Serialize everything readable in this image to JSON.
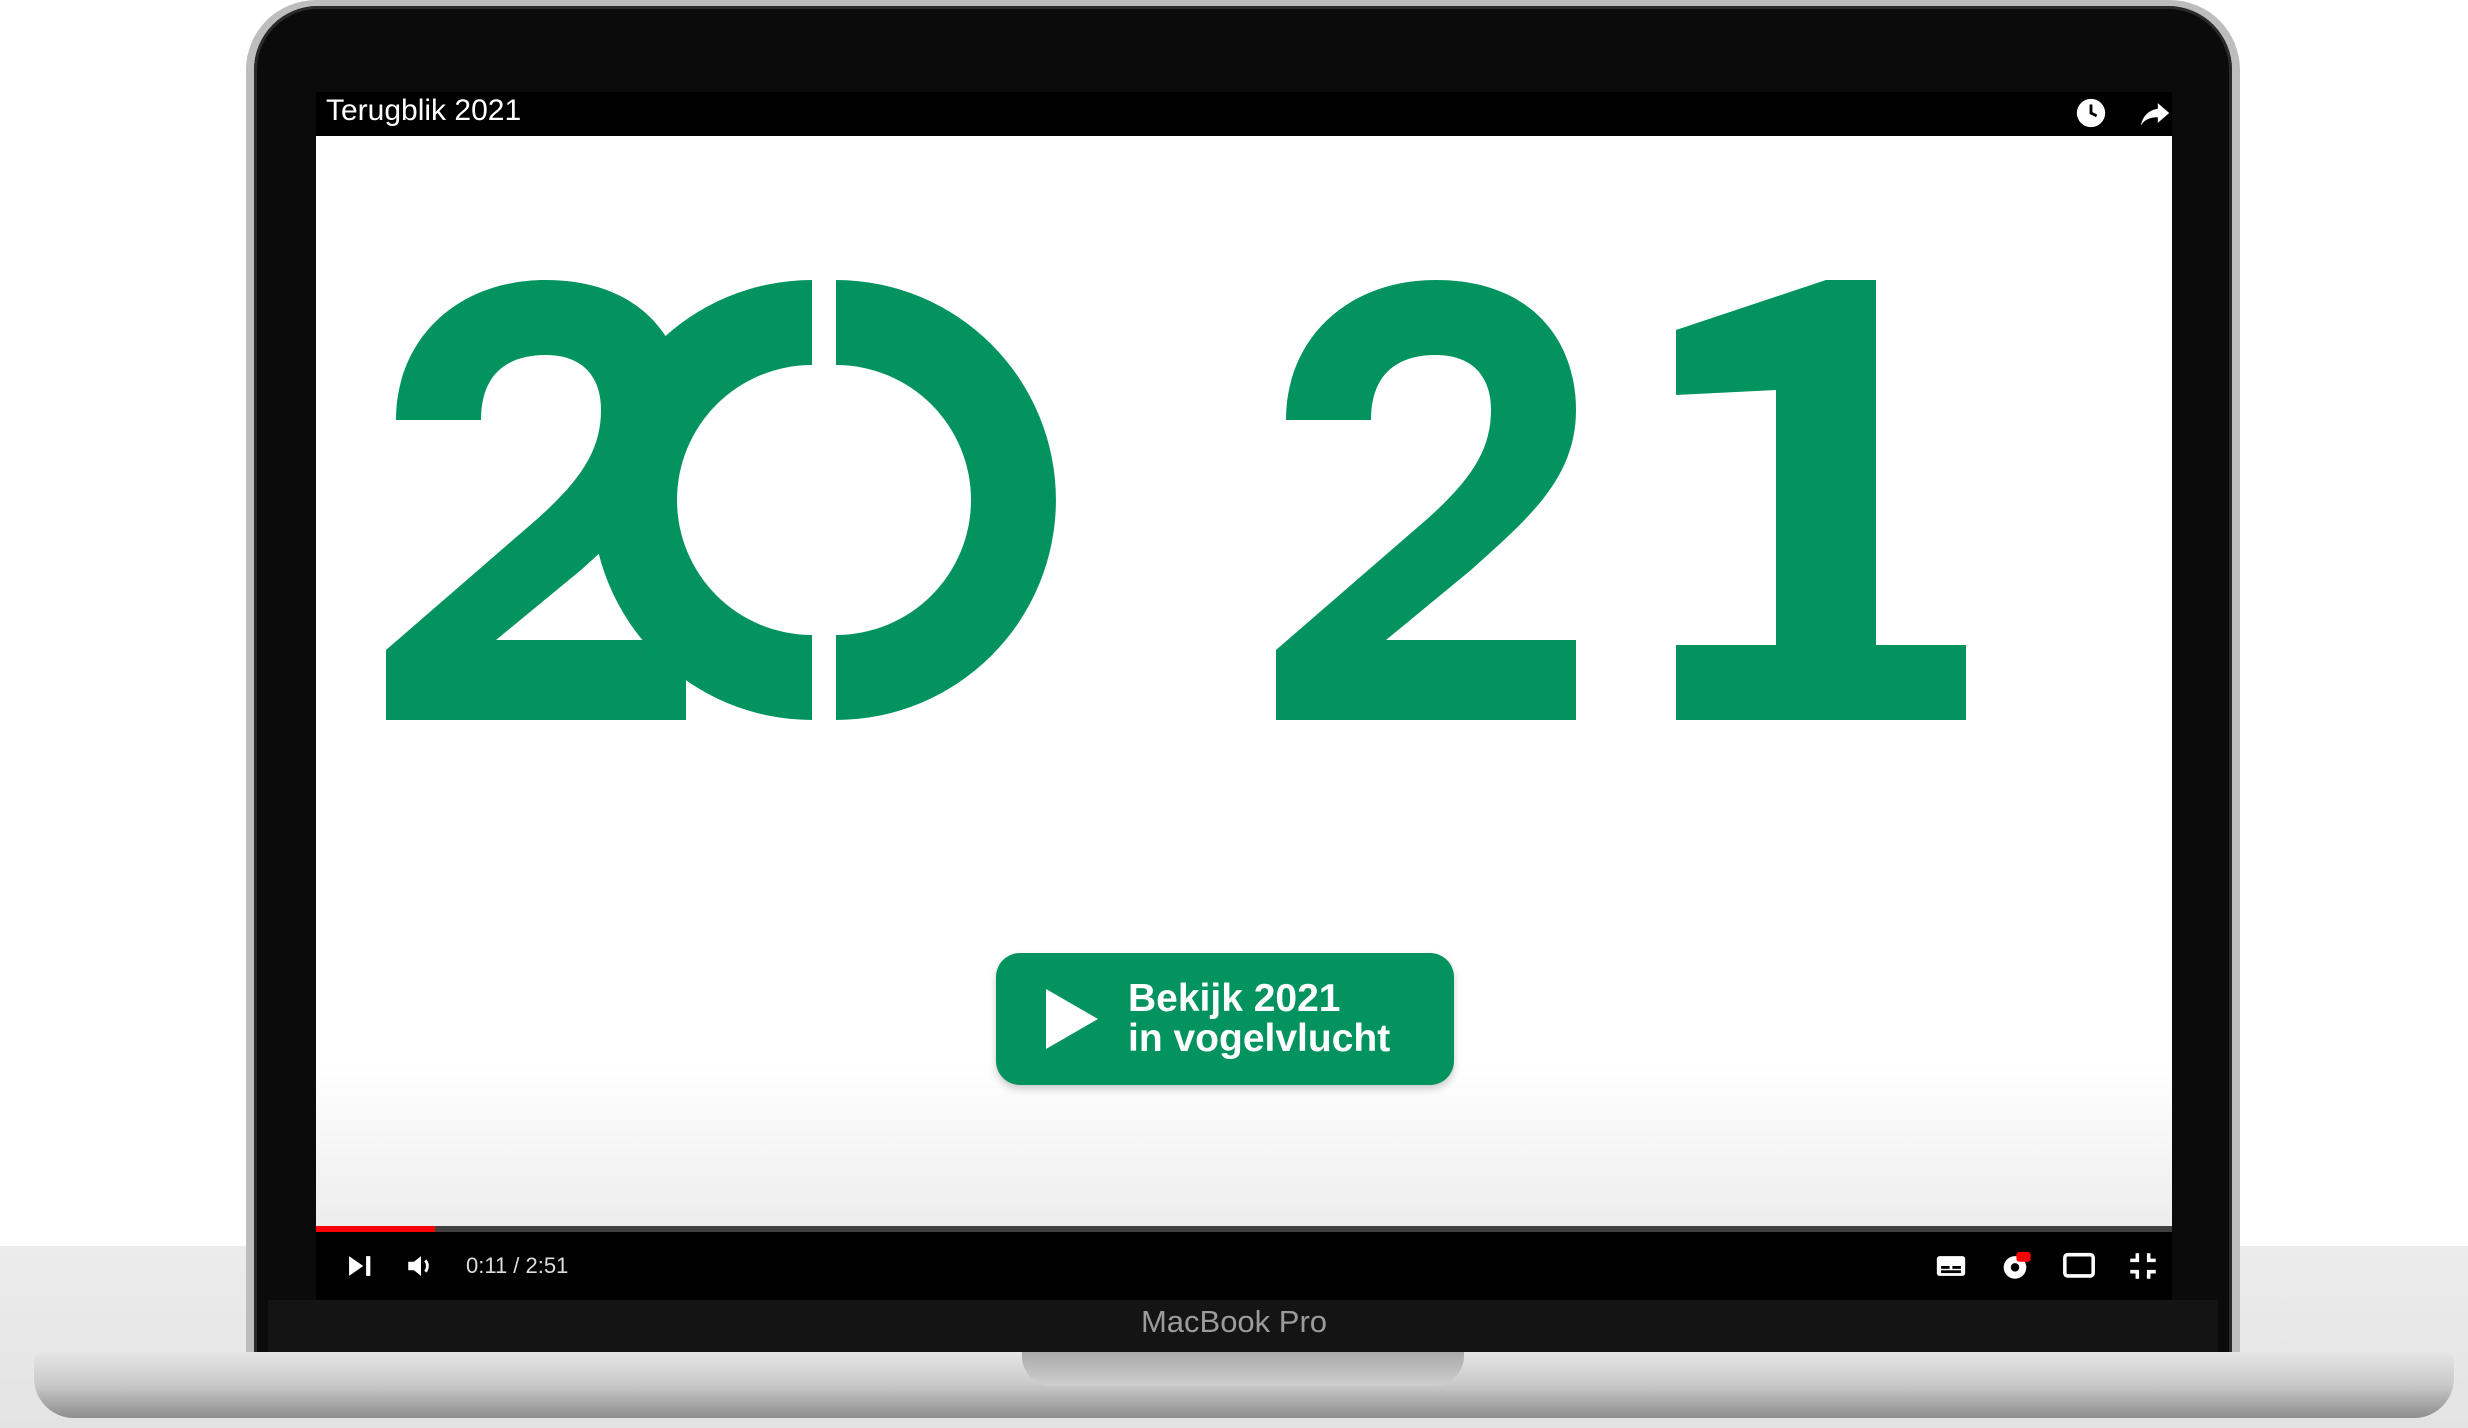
{
  "video": {
    "title": "Terugblik 2021",
    "headline": "2021",
    "cta_line1": "Bekijk 2021",
    "cta_line2": "in vogelvlucht",
    "time": "0:11 / 2:51",
    "progress": 0.064
  },
  "device": {
    "brand_label": "MacBook Pro"
  },
  "colors": {
    "brand_green": "#02935f",
    "progress_red": "#ff0000"
  },
  "icons": [
    "clock-icon",
    "share-icon",
    "play-icon",
    "skip-next-icon",
    "volume-icon",
    "subtitles-icon",
    "settings-icon",
    "cast-icon",
    "exit-fullscreen-icon"
  ]
}
